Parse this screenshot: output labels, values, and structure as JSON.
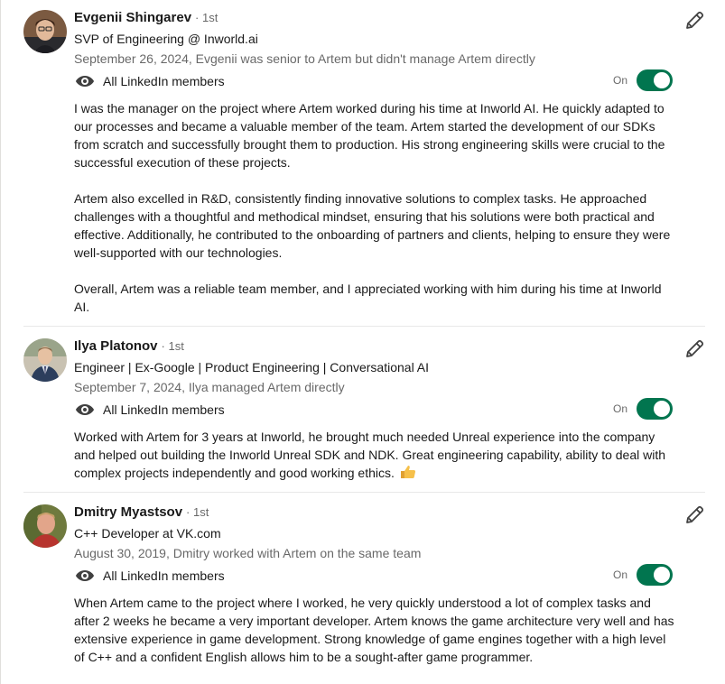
{
  "recommendations": [
    {
      "name": "Evgenii Shingarev",
      "degree": "· 1st",
      "headline": "SVP of Engineering @ Inworld.ai",
      "meta": "September 26, 2024, Evgenii was senior to Artem but didn't manage Artem directly",
      "visibility": "All LinkedIn members",
      "toggle_label": "On",
      "paragraphs": [
        "I was the manager on the project where Artem worked during his time at Inworld AI. He quickly adapted to our processes and became a valuable member of the team. Artem started the development of our SDKs from scratch and successfully brought them to production. His strong engineering skills were crucial to the successful execution of these projects.",
        "Artem also excelled in R&D, consistently finding innovative solutions to complex tasks. He approached challenges with a thoughtful and methodical mindset, ensuring that his solutions were both practical and effective. Additionally, he contributed to the onboarding of partners and clients, helping to ensure they were well-supported with our technologies.",
        "Overall, Artem was a reliable team member, and I appreciated working with him during his time at Inworld AI."
      ]
    },
    {
      "name": "Ilya Platonov",
      "degree": "· 1st",
      "headline": "Engineer | Ex-Google | Product Engineering | Conversational AI",
      "meta": "September 7, 2024, Ilya managed Artem directly",
      "visibility": "All LinkedIn members",
      "toggle_label": "On",
      "paragraphs": [
        "Worked with Artem for 3 years at Inworld, he brought much needed Unreal experience into the company and helped out building the Inworld Unreal SDK and NDK. Great engineering capability, ability to deal with complex projects independently and good working ethics."
      ],
      "emoji": "thumbs-up-icon"
    },
    {
      "name": "Dmitry Myastsov",
      "degree": "· 1st",
      "headline": "C++ Developer at VK.com",
      "meta": "August 30, 2019, Dmitry worked with Artem on the same team",
      "visibility": "All LinkedIn members",
      "toggle_label": "On",
      "paragraphs": [
        "When Artem came to the project where I worked, he very quickly understood a lot of complex tasks and after 2 weeks he became a very important developer. Artem knows the game architecture very well and has extensive experience in game development. Strong knowledge of game engines together with a high level of C++ and a confident English allows him to be a sought-after game programmer."
      ]
    }
  ],
  "icons": {
    "edit": "pencil-icon",
    "visibility": "eye-icon",
    "emoji": "thumbs-up-icon"
  },
  "colors": {
    "toggle_on": "#01754f",
    "divider": "#e8e8e8"
  }
}
